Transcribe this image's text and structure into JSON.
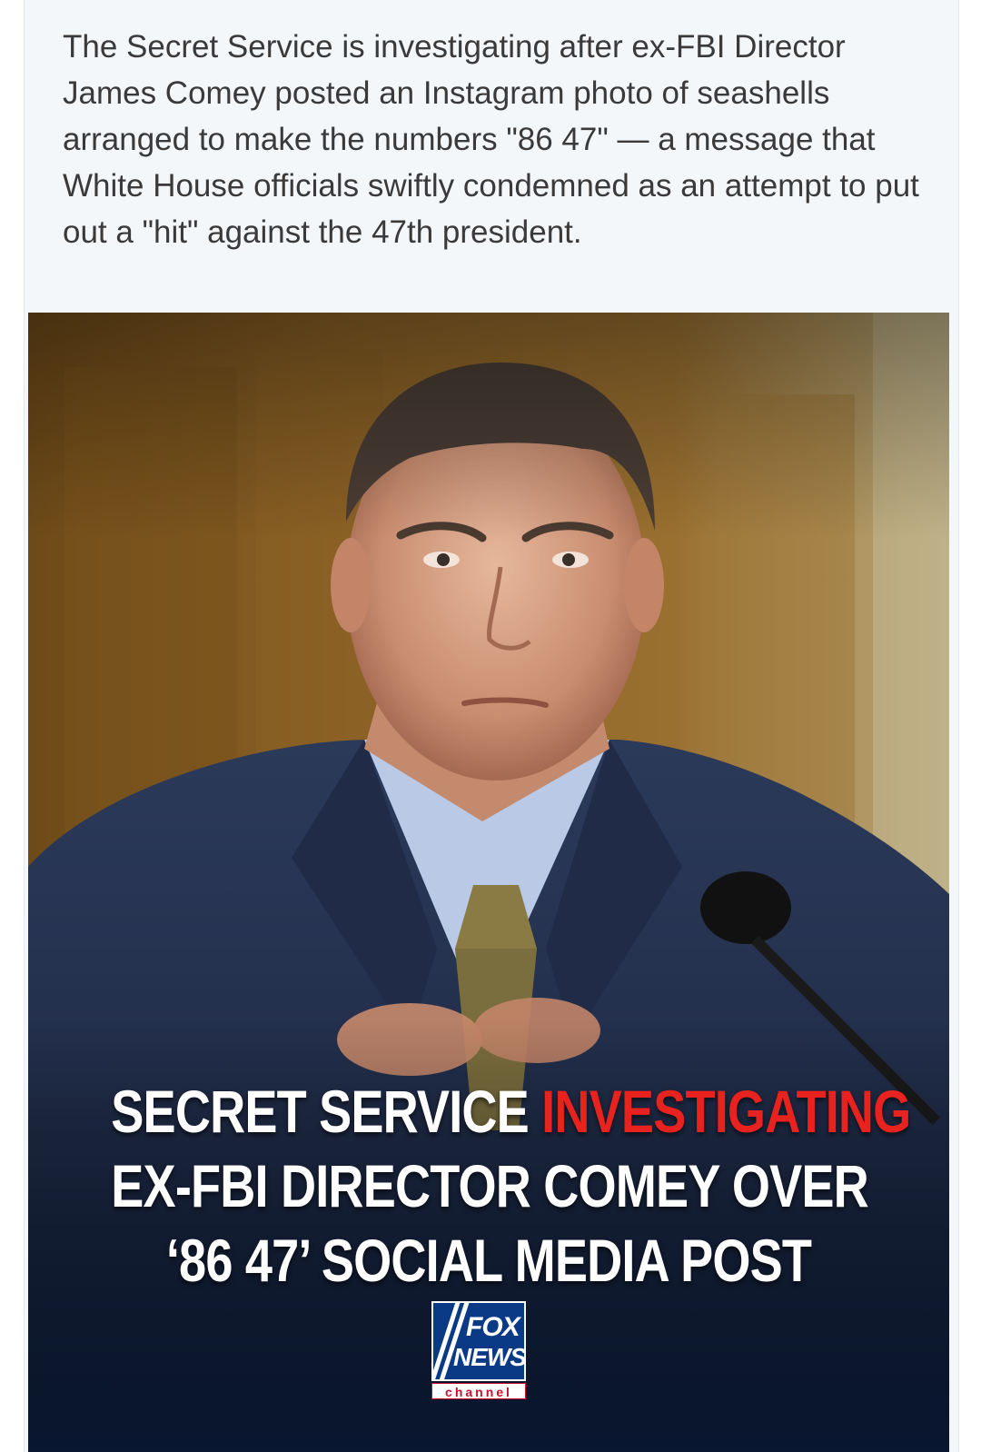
{
  "post": {
    "text": "The Secret Service is investigating after ex-FBI Director James Comey posted an Instagram photo of seashells arranged to make the numbers \"86 47\" — a message that White House officials swiftly condemned as an attempt to put out a \"hit\" against the 47th president."
  },
  "image": {
    "headline": {
      "line1_white": "SECRET SERVICE ",
      "line1_red": "INVESTIGATING",
      "line2": "EX-FBI DIRECTOR COMEY OVER",
      "line3": "‘86 47’ SOCIAL MEDIA POST"
    },
    "logo": {
      "word1": "FOX",
      "word2": "NEWS",
      "word3": "channel"
    },
    "colors": {
      "highlight": "#e8221f",
      "logo_blue": "#0a3a86"
    }
  }
}
